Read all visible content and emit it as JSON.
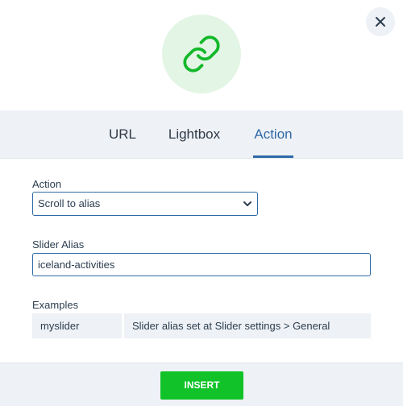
{
  "dialog": {
    "close_icon": "close-icon",
    "hero_icon": "link-icon",
    "hero_color": "#12b82a"
  },
  "tabs": [
    {
      "label": "URL",
      "active": false
    },
    {
      "label": "Lightbox",
      "active": false
    },
    {
      "label": "Action",
      "active": true
    }
  ],
  "form": {
    "action_label": "Action",
    "action_value": "Scroll to alias",
    "slider_alias_label": "Slider Alias",
    "slider_alias_value": "iceland-activities",
    "examples_label": "Examples",
    "examples": [
      {
        "key": "myslider",
        "description": "Slider alias set at Slider settings > General"
      }
    ]
  },
  "footer": {
    "insert_label": "INSERT"
  }
}
